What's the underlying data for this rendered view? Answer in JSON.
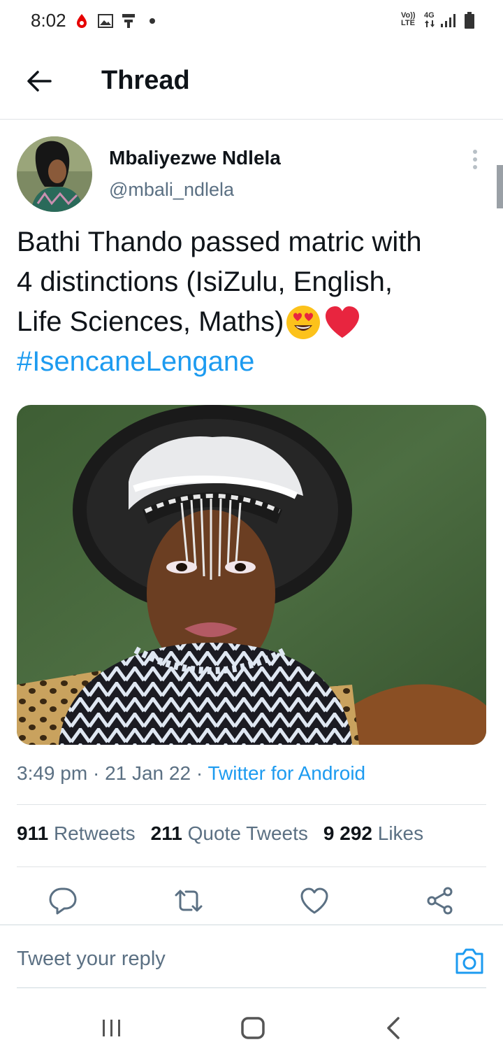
{
  "status_bar": {
    "time": "8:02",
    "network_label_top": "Vo))",
    "network_label_bottom": "LTE",
    "data_label": "4G"
  },
  "header": {
    "title": "Thread"
  },
  "tweet": {
    "author_name": "Mbaliyezwe Ndlela",
    "author_handle": "@mbali_ndlela",
    "text_lines": [
      "Bathi Thando passed matric with",
      "4 distinctions (IsiZulu, English,",
      "Life Sciences, Maths)"
    ],
    "hashtag": "#IsencaneLengane",
    "time": "3:49 pm",
    "date": "21 Jan 22",
    "source": "Twitter for Android",
    "retweets_count": "911",
    "retweets_label": "Retweets",
    "quotes_count": "211",
    "quotes_label": "Quote Tweets",
    "likes_count": "9 292",
    "likes_label": "Likes"
  },
  "reply": {
    "placeholder": "Tweet your reply"
  },
  "colors": {
    "accent": "#1d9bf0",
    "muted": "#5b7083",
    "text": "#0f1419",
    "heart": "#e8253f"
  },
  "icons": [
    "back-arrow-icon",
    "more-vertical-icon",
    "reply-icon",
    "retweet-icon",
    "like-icon",
    "share-icon",
    "camera-icon",
    "nav-recents-icon",
    "nav-home-icon",
    "nav-back-icon"
  ]
}
